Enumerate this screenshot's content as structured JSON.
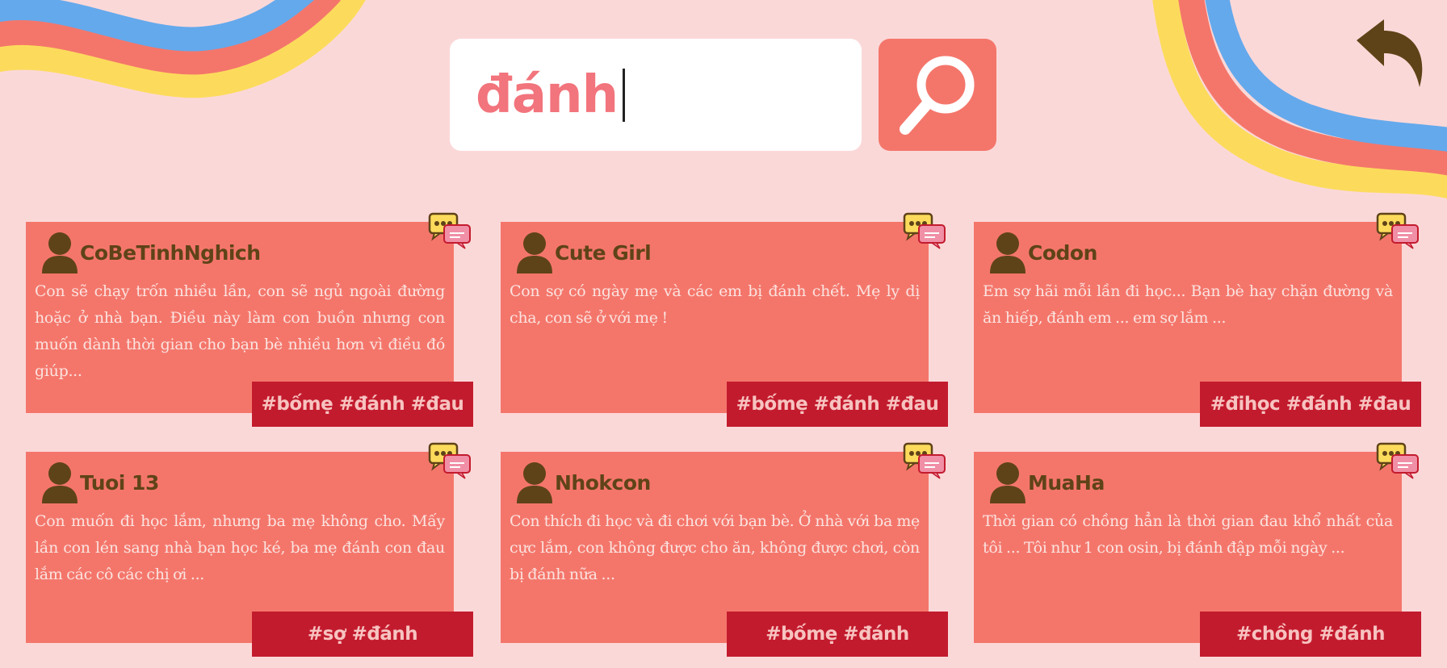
{
  "colors": {
    "background": "#fbd8d8",
    "card": "#f4766b",
    "tag": "#c31b2e",
    "tag_text": "#f7c3c0",
    "brown": "#5f4318",
    "search_text": "#f2747c",
    "stripe_blue": "#64a9ec",
    "stripe_red": "#f4766b",
    "stripe_yellow": "#fcdb5c"
  },
  "search": {
    "value": "đánh",
    "button_icon": "magnifier-icon"
  },
  "header": {
    "back_icon": "back-arrow-icon"
  },
  "posts": [
    {
      "username": "CoBeTinhNghich",
      "text": "Con sẽ chạy trốn nhiều lần, con sẽ ngủ ngoài đường hoặc ở nhà bạn. Điều này làm con buồn nhưng con muốn dành thời gian cho bạn bè nhiều hơn vì điều đó giúp...",
      "tags": "#bốmẹ #đánh #đau"
    },
    {
      "username": "Cute Girl",
      "text": "Con sợ có ngày mẹ và các em bị đánh chết. Mẹ ly dị cha, con sẽ ở với mẹ !",
      "tags": "#bốmẹ #đánh #đau"
    },
    {
      "username": "Codon",
      "text": "Em sợ hãi mỗi lần đi học... Bạn bè hay chặn đường và ăn hiếp, đánh em ... em sợ lắm ...",
      "tags": "#đihọc #đánh #đau"
    },
    {
      "username": "Tuoi 13",
      "text": "Con muốn đi học lắm, nhưng ba mẹ không cho. Mấy lần con lén sang nhà bạn học ké, ba mẹ đánh con đau lắm các cô các chị ơi ...",
      "tags": "#sợ #đánh"
    },
    {
      "username": "Nhokcon",
      "text": "Con thích đi học và đi chơi với bạn bè. Ở nhà với ba mẹ cực lắm, con không được cho ăn, không được chơi, còn bị đánh nữa ...",
      "tags": "#bốmẹ #đánh"
    },
    {
      "username": "MuaHa",
      "text": "Thời gian có chồng hẳn là thời gian đau khổ nhất của tôi ... Tôi như 1 con osin, bị đánh đập mỗi ngày ...",
      "tags": "#chồng #đánh"
    }
  ]
}
